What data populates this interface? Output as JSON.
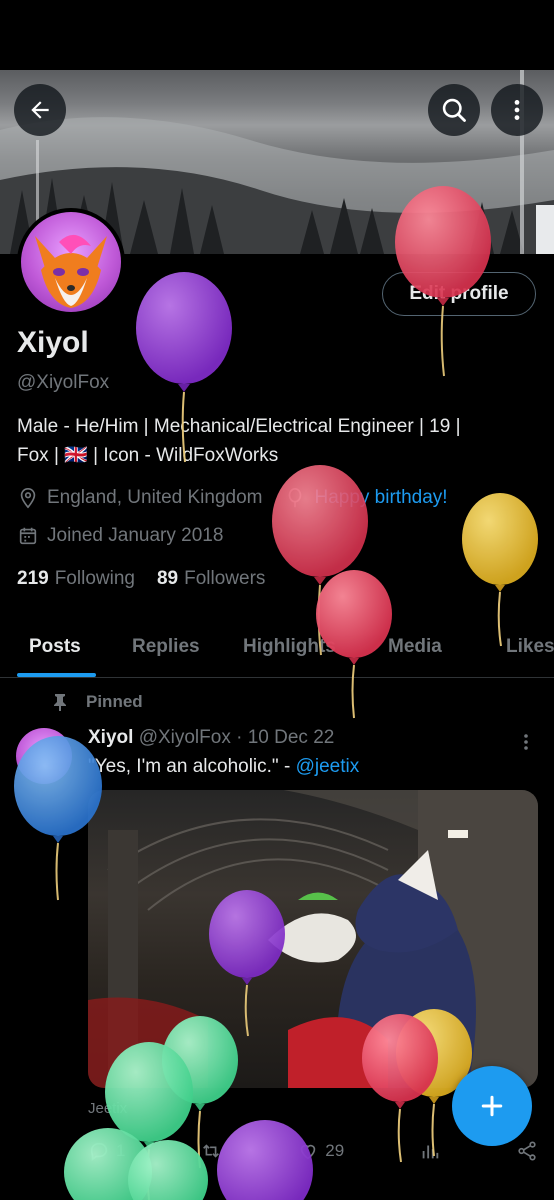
{
  "header": {
    "back_icon": "arrow-left-icon",
    "search_icon": "search-icon",
    "more_icon": "more-vertical-icon"
  },
  "profile": {
    "name": "Xiyol",
    "handle": "@XiyolFox",
    "edit_label": "Edit profile",
    "bio_line1": "Male - He/Him | Mechanical/Electrical Engineer | 19 |",
    "bio_line2": "Fox | 🇬🇧 |  Icon - WildFoxWorks",
    "location": "England, United Kingdom",
    "birthday": "Happy birthday!",
    "joined": "Joined January 2018",
    "following_count": "219",
    "following_label": "Following",
    "followers_count": "89",
    "followers_label": "Followers"
  },
  "tabs": [
    {
      "label": "Posts",
      "active": true
    },
    {
      "label": "Replies",
      "active": false
    },
    {
      "label": "Highlights",
      "active": false
    },
    {
      "label": "Media",
      "active": false
    },
    {
      "label": "Likes",
      "active": false
    }
  ],
  "pinned_tweet": {
    "pinned_label": "Pinned",
    "author": "Xiyol",
    "handle": "@XiyolFox",
    "separator": "·",
    "date": "10 Dec 22",
    "text": "\"Yes, I'm an alcoholic.\" - ",
    "mention": "@jeetix",
    "media_caption": "Jeetix",
    "reply_count": "1",
    "like_count": "29"
  },
  "colors": {
    "accent": "#1d9bf0",
    "background": "#000000",
    "text_primary": "#e7e9ea",
    "text_secondary": "#71767b",
    "balloon_red": "#e64a63",
    "balloon_purple": "#9b3fd6",
    "balloon_yellow": "#e8c23a",
    "balloon_blue": "#3b8de0",
    "balloon_green": "#5ee0a0"
  }
}
